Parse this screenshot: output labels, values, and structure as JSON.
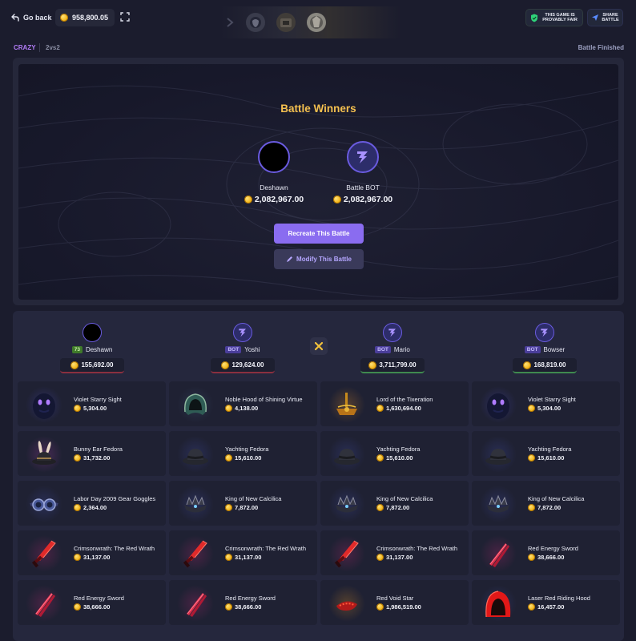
{
  "header": {
    "go_back_label": "Go back",
    "balance": "958,800.05",
    "fair_label_line1": "THIS GAME IS",
    "fair_label_line2": "PROVABLY FAIR",
    "share_label_line1": "SHARE",
    "share_label_line2": "BATTLE"
  },
  "battle_meta": {
    "mode": "CRAZY",
    "format": "2vs2",
    "status": "Battle Finished"
  },
  "winners": {
    "title": "Battle Winners",
    "list": [
      {
        "name": "Deshawn",
        "amount": "2,082,967.00"
      },
      {
        "name": "Battle BOT",
        "amount": "2,082,967.00"
      }
    ],
    "recreate_label": "Recreate This Battle",
    "modify_label": "Modify This Battle"
  },
  "players": [
    {
      "name": "Deshawn",
      "badge": "73",
      "amount": "155,692.00",
      "result": "loss"
    },
    {
      "name": "Yoshi",
      "badge": "BOT",
      "amount": "129,624.00",
      "result": "loss"
    },
    {
      "name": "Mario",
      "badge": "BOT",
      "amount": "3,711,799.00",
      "result": "win"
    },
    {
      "name": "Bowser",
      "badge": "BOT",
      "amount": "168,819.00",
      "result": "win"
    }
  ],
  "items": [
    [
      {
        "name": "Violet Starry Sight",
        "value": "5,304.00",
        "icon": "violet-eyes-icon"
      },
      {
        "name": "Noble Hood of Shining Virtue",
        "value": "4,138.00",
        "icon": "hood-icon"
      },
      {
        "name": "Lord of the Tixeration",
        "value": "1,630,694.00",
        "icon": "golden-crown-icon"
      },
      {
        "name": "Violet Starry Sight",
        "value": "5,304.00",
        "icon": "violet-eyes-icon"
      }
    ],
    [
      {
        "name": "Bunny Ear Fedora",
        "value": "31,732.00",
        "icon": "bunny-fedora-icon"
      },
      {
        "name": "Yachting Fedora",
        "value": "15,610.00",
        "icon": "fedora-icon"
      },
      {
        "name": "Yachting Fedora",
        "value": "15,610.00",
        "icon": "fedora-icon"
      },
      {
        "name": "Yachting Fedora",
        "value": "15,610.00",
        "icon": "fedora-icon"
      }
    ],
    [
      {
        "name": "Labor Day 2009 Gear Goggles",
        "value": "2,364.00",
        "icon": "goggles-icon"
      },
      {
        "name": "King of New Calcilica",
        "value": "7,872.00",
        "icon": "crown-icon"
      },
      {
        "name": "King of New Calcilica",
        "value": "7,872.00",
        "icon": "crown-icon"
      },
      {
        "name": "King of New Calcilica",
        "value": "7,872.00",
        "icon": "crown-icon"
      }
    ],
    [
      {
        "name": "Crimsonwrath: The Red Wrath",
        "value": "31,137.00",
        "icon": "red-sword-icon"
      },
      {
        "name": "Crimsonwrath: The Red Wrath",
        "value": "31,137.00",
        "icon": "red-sword-icon"
      },
      {
        "name": "Crimsonwrath: The Red Wrath",
        "value": "31,137.00",
        "icon": "red-sword-icon"
      },
      {
        "name": "Red Energy Sword",
        "value": "38,666.00",
        "icon": "energy-sword-icon"
      }
    ],
    [
      {
        "name": "Red Energy Sword",
        "value": "38,666.00",
        "icon": "energy-sword-icon"
      },
      {
        "name": "Red Energy Sword",
        "value": "38,666.00",
        "icon": "energy-sword-icon"
      },
      {
        "name": "Red Void Star",
        "value": "1,986,519.00",
        "icon": "void-star-icon"
      },
      {
        "name": "Laser Red Riding Hood",
        "value": "16,457.00",
        "icon": "red-hood-icon"
      }
    ]
  ],
  "colors": {
    "accent": "#8a6cf0",
    "gold": "#f4c04f",
    "mode": "#b27cf7",
    "background": "#1b1c2d"
  }
}
